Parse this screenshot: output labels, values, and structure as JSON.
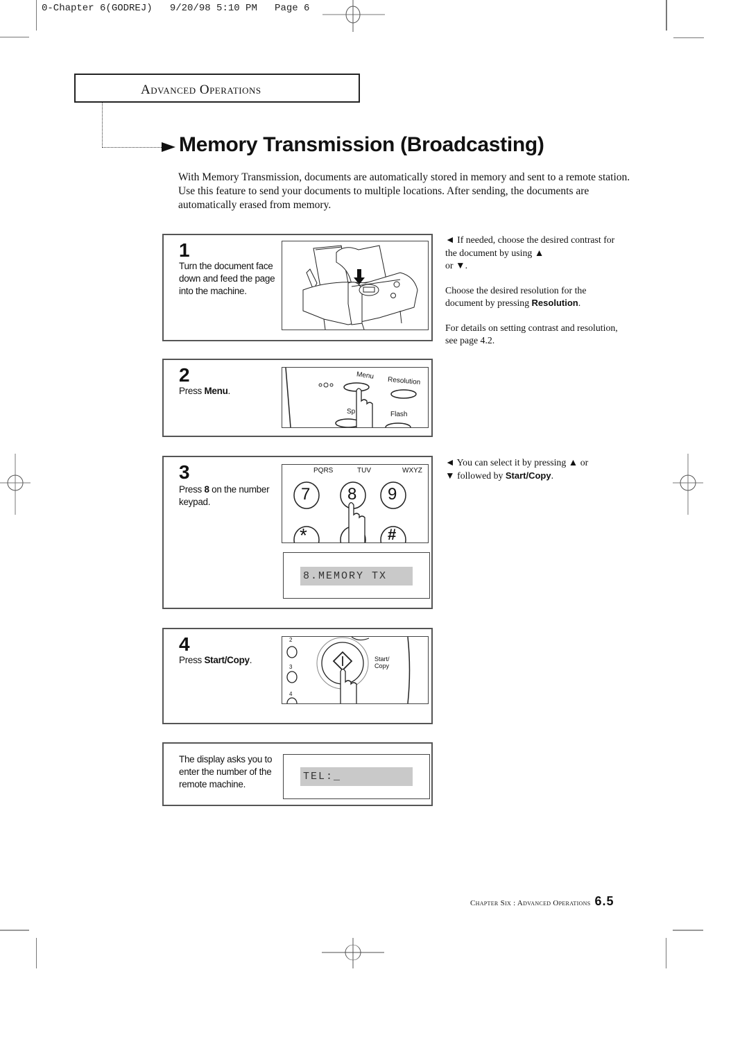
{
  "slug": {
    "text": "0-Chapter 6(GODREJ)   9/20/98 5:10 PM   Page 6"
  },
  "section": {
    "label": "Advanced Operations"
  },
  "page_title": "Memory Transmission (Broadcasting)",
  "intro": "With Memory Transmission, documents are automatically stored in memory and sent to a remote station. Use this feature to send your documents to multiple locations. After sending, the documents are automatically erased from memory.",
  "steps": [
    {
      "number": "1",
      "text": "Turn the document face down and feed the page into the machine."
    },
    {
      "number": "2",
      "text_prefix": "Press ",
      "text_bold": "Menu",
      "text_suffix": ".",
      "illustration": {
        "labels": [
          "Menu",
          "Resolution",
          "Sp",
          "Flash"
        ]
      }
    },
    {
      "number": "3",
      "text_prefix": "Press ",
      "text_bold": "8",
      "text_suffix": " on the number keypad.",
      "illustration": {
        "letters": [
          "PQRS",
          "TUV",
          "WXYZ"
        ],
        "keys": [
          "7",
          "8",
          "9",
          "*",
          "#"
        ]
      },
      "display": "8.MEMORY TX"
    },
    {
      "number": "4",
      "text_prefix": "Press ",
      "text_bold": "Start/Copy",
      "text_suffix": ".",
      "illustration": {
        "side_keys": [
          "2",
          "3",
          "4"
        ],
        "button_label_1": "Start/",
        "button_label_2": "Copy"
      }
    },
    {
      "number": "",
      "text": "The display asks you to enter the number of the remote machine.",
      "display": "TEL:_"
    }
  ],
  "notes": {
    "contrast": {
      "arrow": "◄",
      "text_1": " If needed, choose the desired contrast for the document by using ",
      "up": "▲",
      "mid": " or ",
      "down": "▼",
      "end": "."
    },
    "resolution": {
      "text": "Choose the desired resolution for the document by pressing ",
      "bold": "Resolution",
      "end": "."
    },
    "details": "For details on setting contrast and resolution, see page 4.2.",
    "select": {
      "arrow": "◄",
      "text_1": " You can select it by pressing ",
      "up": "▲",
      "mid": " or ",
      "down": "▼",
      "text_2": " followed by ",
      "bold": "Start/Copy",
      "end": "."
    }
  },
  "footer": {
    "chapter": "Chapter Six : Advanced Operations",
    "page": "6.5"
  }
}
